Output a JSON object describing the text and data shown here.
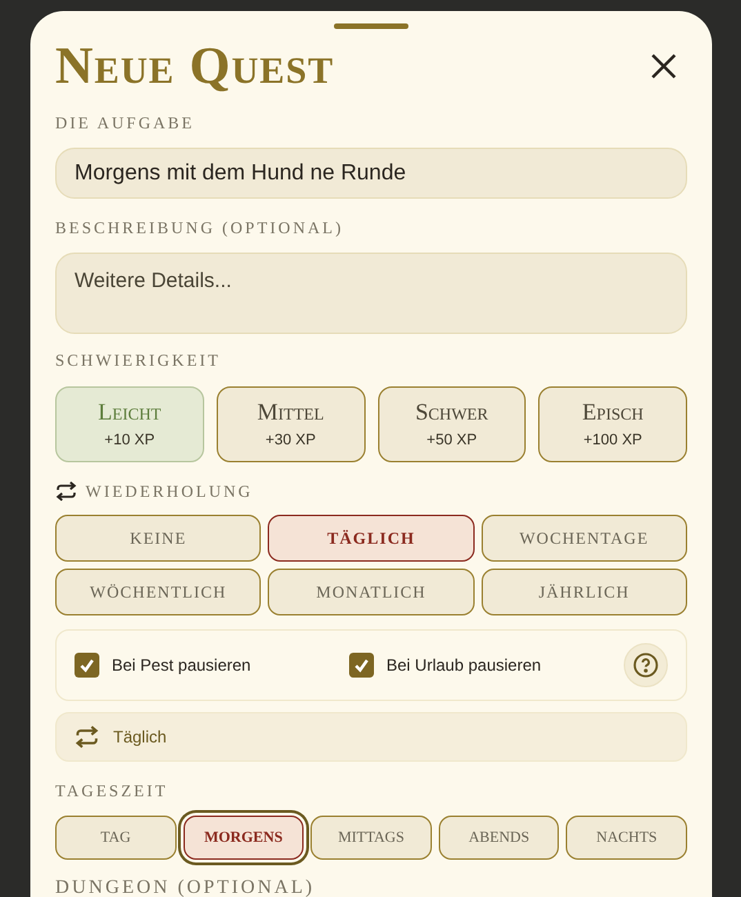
{
  "title": "Neue Quest",
  "task": {
    "label": "DIE AUFGABE",
    "value": "Morgens mit dem Hund ne Runde"
  },
  "description": {
    "label": "BESCHREIBUNG (OPTIONAL)",
    "placeholder": "Weitere Details..."
  },
  "difficulty": {
    "label": "SCHWIERIGKEIT",
    "options": [
      {
        "name": "Leicht",
        "xp": "+10 XP",
        "selected": true
      },
      {
        "name": "Mittel",
        "xp": "+30 XP",
        "selected": false
      },
      {
        "name": "Schwer",
        "xp": "+50 XP",
        "selected": false
      },
      {
        "name": "Episch",
        "xp": "+100 XP",
        "selected": false
      }
    ]
  },
  "repeat": {
    "label": "WIEDERHOLUNG",
    "options": [
      {
        "label": "KEINE",
        "selected": false
      },
      {
        "label": "TÄGLICH",
        "selected": true
      },
      {
        "label": "WOCHENTAGE",
        "selected": false
      },
      {
        "label": "WÖCHENTLICH",
        "selected": false
      },
      {
        "label": "MONATLICH",
        "selected": false
      },
      {
        "label": "JÄHRLICH",
        "selected": false
      }
    ]
  },
  "pause": [
    {
      "label": "Bei Pest pausieren",
      "checked": true
    },
    {
      "label": "Bei Urlaub pausieren",
      "checked": true
    }
  ],
  "summary": "Täglich",
  "time_of_day": {
    "label": "TAGESZEIT",
    "options": [
      {
        "label": "TAG",
        "selected": false,
        "focused": false
      },
      {
        "label": "MORGENS",
        "selected": true,
        "focused": true
      },
      {
        "label": "MITTAGS",
        "selected": false,
        "focused": false
      },
      {
        "label": "ABENDS",
        "selected": false,
        "focused": false
      },
      {
        "label": "NACHTS",
        "selected": false,
        "focused": false
      }
    ]
  },
  "dungeon": {
    "label": "DUNGEON (OPTIONAL)"
  }
}
